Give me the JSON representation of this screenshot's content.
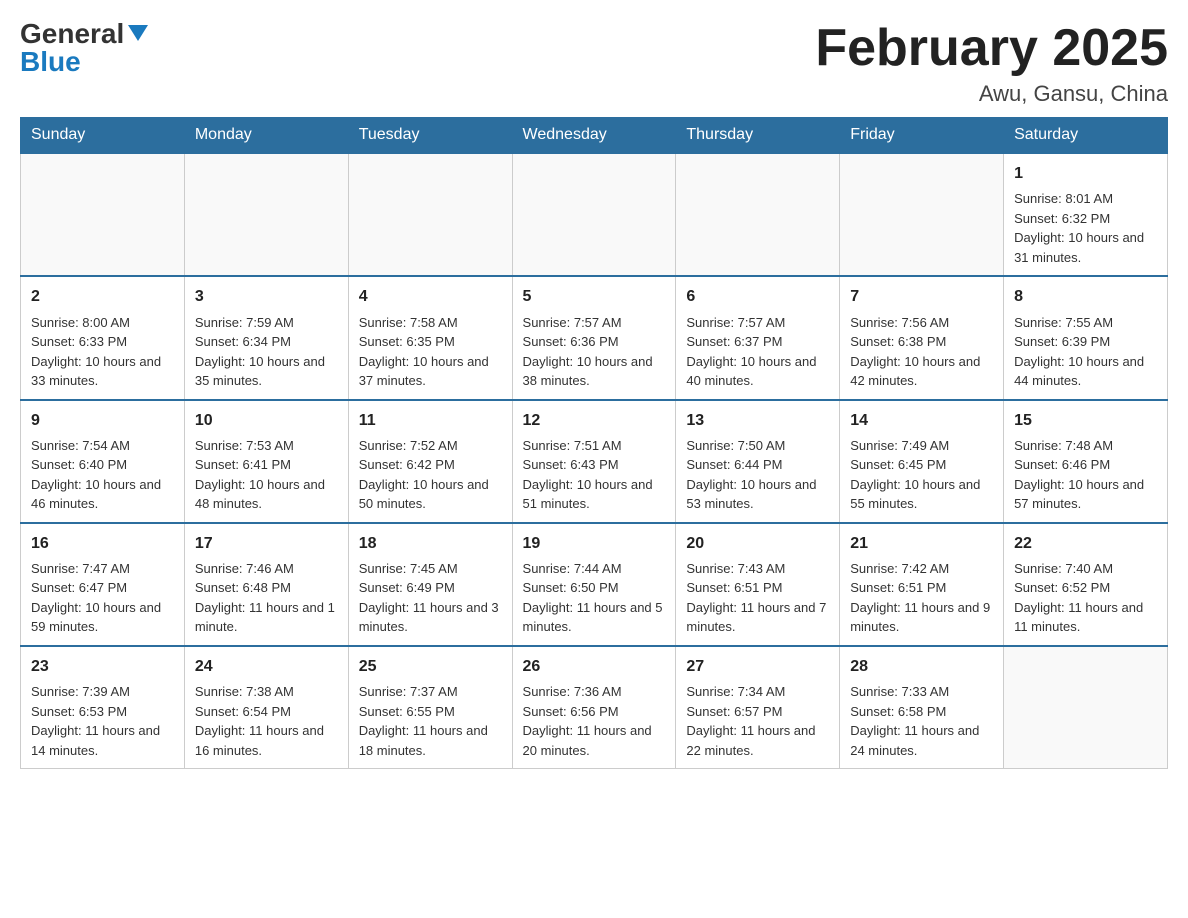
{
  "logo": {
    "general": "General",
    "blue": "Blue"
  },
  "title": {
    "month_year": "February 2025",
    "location": "Awu, Gansu, China"
  },
  "weekdays": [
    "Sunday",
    "Monday",
    "Tuesday",
    "Wednesday",
    "Thursday",
    "Friday",
    "Saturday"
  ],
  "weeks": [
    [
      {
        "day": "",
        "info": ""
      },
      {
        "day": "",
        "info": ""
      },
      {
        "day": "",
        "info": ""
      },
      {
        "day": "",
        "info": ""
      },
      {
        "day": "",
        "info": ""
      },
      {
        "day": "",
        "info": ""
      },
      {
        "day": "1",
        "info": "Sunrise: 8:01 AM\nSunset: 6:32 PM\nDaylight: 10 hours and 31 minutes."
      }
    ],
    [
      {
        "day": "2",
        "info": "Sunrise: 8:00 AM\nSunset: 6:33 PM\nDaylight: 10 hours and 33 minutes."
      },
      {
        "day": "3",
        "info": "Sunrise: 7:59 AM\nSunset: 6:34 PM\nDaylight: 10 hours and 35 minutes."
      },
      {
        "day": "4",
        "info": "Sunrise: 7:58 AM\nSunset: 6:35 PM\nDaylight: 10 hours and 37 minutes."
      },
      {
        "day": "5",
        "info": "Sunrise: 7:57 AM\nSunset: 6:36 PM\nDaylight: 10 hours and 38 minutes."
      },
      {
        "day": "6",
        "info": "Sunrise: 7:57 AM\nSunset: 6:37 PM\nDaylight: 10 hours and 40 minutes."
      },
      {
        "day": "7",
        "info": "Sunrise: 7:56 AM\nSunset: 6:38 PM\nDaylight: 10 hours and 42 minutes."
      },
      {
        "day": "8",
        "info": "Sunrise: 7:55 AM\nSunset: 6:39 PM\nDaylight: 10 hours and 44 minutes."
      }
    ],
    [
      {
        "day": "9",
        "info": "Sunrise: 7:54 AM\nSunset: 6:40 PM\nDaylight: 10 hours and 46 minutes."
      },
      {
        "day": "10",
        "info": "Sunrise: 7:53 AM\nSunset: 6:41 PM\nDaylight: 10 hours and 48 minutes."
      },
      {
        "day": "11",
        "info": "Sunrise: 7:52 AM\nSunset: 6:42 PM\nDaylight: 10 hours and 50 minutes."
      },
      {
        "day": "12",
        "info": "Sunrise: 7:51 AM\nSunset: 6:43 PM\nDaylight: 10 hours and 51 minutes."
      },
      {
        "day": "13",
        "info": "Sunrise: 7:50 AM\nSunset: 6:44 PM\nDaylight: 10 hours and 53 minutes."
      },
      {
        "day": "14",
        "info": "Sunrise: 7:49 AM\nSunset: 6:45 PM\nDaylight: 10 hours and 55 minutes."
      },
      {
        "day": "15",
        "info": "Sunrise: 7:48 AM\nSunset: 6:46 PM\nDaylight: 10 hours and 57 minutes."
      }
    ],
    [
      {
        "day": "16",
        "info": "Sunrise: 7:47 AM\nSunset: 6:47 PM\nDaylight: 10 hours and 59 minutes."
      },
      {
        "day": "17",
        "info": "Sunrise: 7:46 AM\nSunset: 6:48 PM\nDaylight: 11 hours and 1 minute."
      },
      {
        "day": "18",
        "info": "Sunrise: 7:45 AM\nSunset: 6:49 PM\nDaylight: 11 hours and 3 minutes."
      },
      {
        "day": "19",
        "info": "Sunrise: 7:44 AM\nSunset: 6:50 PM\nDaylight: 11 hours and 5 minutes."
      },
      {
        "day": "20",
        "info": "Sunrise: 7:43 AM\nSunset: 6:51 PM\nDaylight: 11 hours and 7 minutes."
      },
      {
        "day": "21",
        "info": "Sunrise: 7:42 AM\nSunset: 6:51 PM\nDaylight: 11 hours and 9 minutes."
      },
      {
        "day": "22",
        "info": "Sunrise: 7:40 AM\nSunset: 6:52 PM\nDaylight: 11 hours and 11 minutes."
      }
    ],
    [
      {
        "day": "23",
        "info": "Sunrise: 7:39 AM\nSunset: 6:53 PM\nDaylight: 11 hours and 14 minutes."
      },
      {
        "day": "24",
        "info": "Sunrise: 7:38 AM\nSunset: 6:54 PM\nDaylight: 11 hours and 16 minutes."
      },
      {
        "day": "25",
        "info": "Sunrise: 7:37 AM\nSunset: 6:55 PM\nDaylight: 11 hours and 18 minutes."
      },
      {
        "day": "26",
        "info": "Sunrise: 7:36 AM\nSunset: 6:56 PM\nDaylight: 11 hours and 20 minutes."
      },
      {
        "day": "27",
        "info": "Sunrise: 7:34 AM\nSunset: 6:57 PM\nDaylight: 11 hours and 22 minutes."
      },
      {
        "day": "28",
        "info": "Sunrise: 7:33 AM\nSunset: 6:58 PM\nDaylight: 11 hours and 24 minutes."
      },
      {
        "day": "",
        "info": ""
      }
    ]
  ]
}
